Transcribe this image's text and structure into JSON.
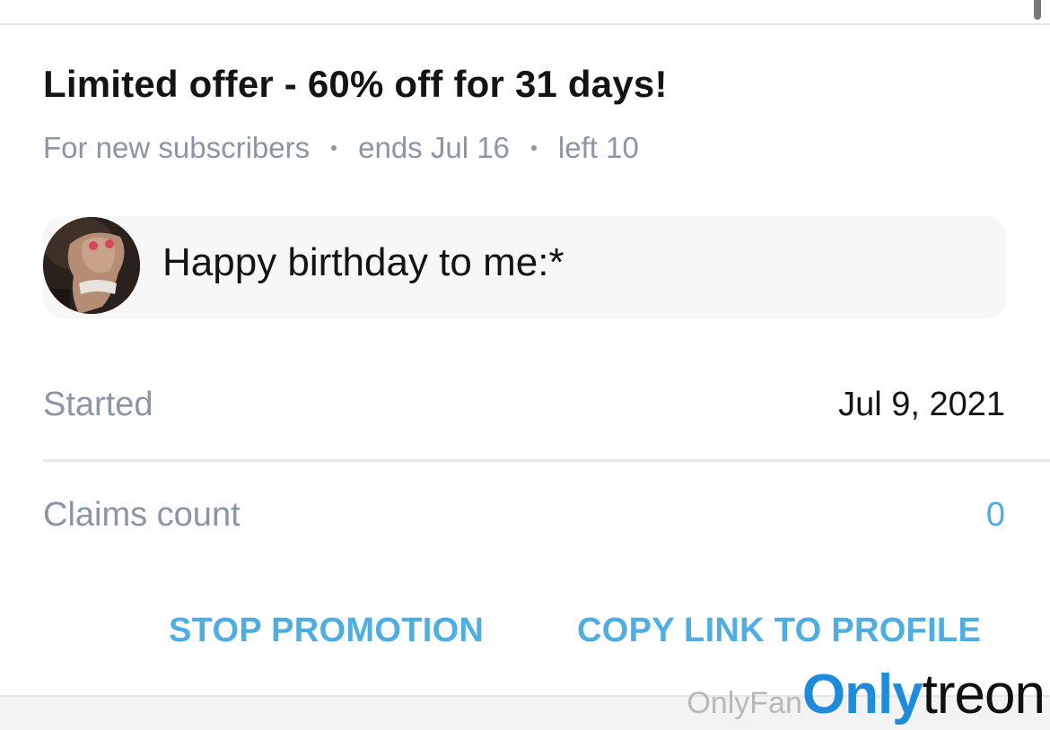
{
  "offer": {
    "title": "Limited offer - 60% off for 31 days!",
    "audience": "For new subscribers",
    "ends": "ends Jul 16",
    "left": "left 10"
  },
  "message": {
    "avatar_icon": "user-avatar-photo",
    "text": "Happy birthday to me:*"
  },
  "stats": {
    "started_label": "Started",
    "started_value": "Jul 9, 2021",
    "claims_label": "Claims count",
    "claims_value": "0"
  },
  "actions": {
    "stop_label": "STOP PROMOTION",
    "copy_label": "COPY LINK TO PROFILE"
  },
  "watermark": {
    "prefix": "OnlyFan",
    "brand_blue": "Only",
    "brand_black": "treon"
  },
  "colors": {
    "accent": "#4eaee2",
    "muted_text": "#8a96a3",
    "primary_text": "#141414",
    "claims_value": "#4eaee2"
  }
}
